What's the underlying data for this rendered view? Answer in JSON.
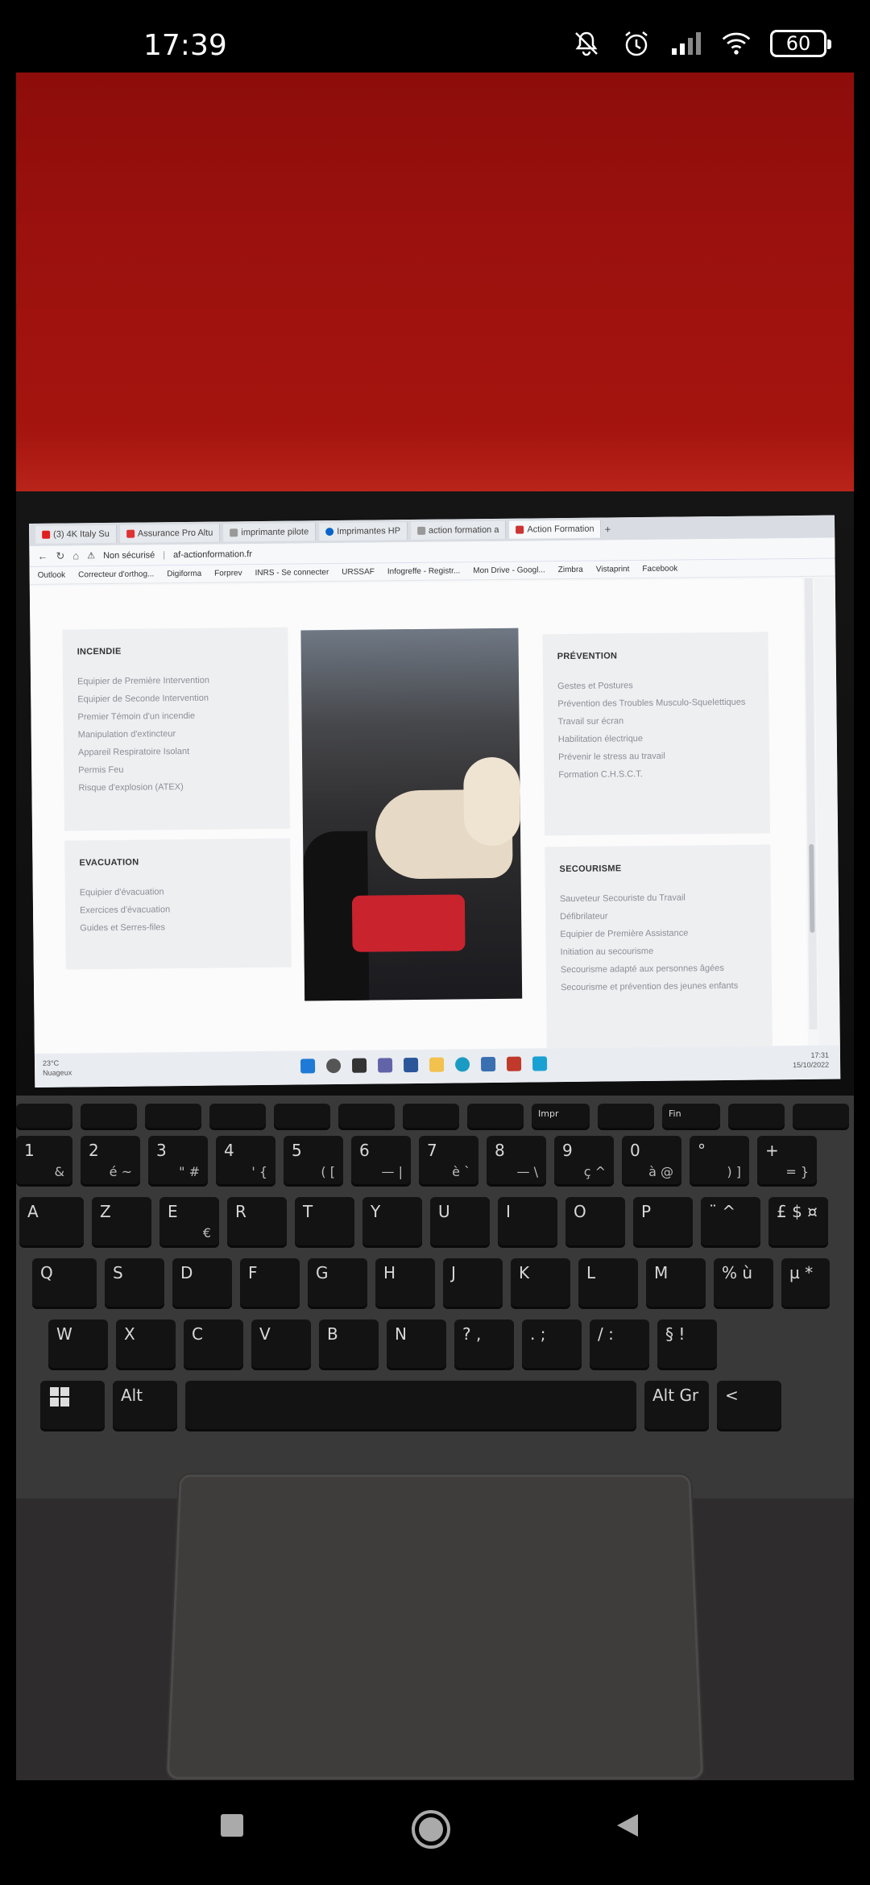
{
  "status_bar": {
    "time": "17:39",
    "battery": "60",
    "icons": [
      "mute-icon",
      "alarm-icon",
      "signal-icon",
      "wifi-icon"
    ]
  },
  "browser": {
    "tabs": [
      "(3) 4K Italy Su",
      "Assurance Pro Altu",
      "imprimante pilote",
      "Imprimantes HP",
      "action formation a",
      "Action Formation"
    ],
    "security_label": "Non sécurisé",
    "url": "af-actionformation.fr",
    "bookmarks": [
      "Outlook",
      "Correcteur d'orthog...",
      "Digiforma",
      "Forprev",
      "INRS - Se connecter",
      "URSSAF",
      "Infogreffe - Registr...",
      "Mon Drive - Googl...",
      "Zimbra",
      "Vistaprint",
      "Facebook"
    ]
  },
  "catalog": {
    "incendie": {
      "title": "INCENDIE",
      "items": [
        "Equipier de Première Intervention",
        "Equipier de Seconde Intervention",
        "Premier Témoin d'un incendie",
        "Manipulation d'extincteur",
        "Appareil Respiratoire Isolant",
        "Permis Feu",
        "Risque d'explosion (ATEX)"
      ]
    },
    "evacuation": {
      "title": "EVACUATION",
      "items": [
        "Equipier d'évacuation",
        "Exercices d'évacuation",
        "Guides et Serres-files"
      ]
    },
    "prevention": {
      "title": "PRÉVENTION",
      "items": [
        "Gestes et Postures",
        "Prévention des Troubles Musculo-Squelettiques",
        "Travail sur écran",
        "Habilitation électrique",
        "Prévenir le stress au travail",
        "Formation C.H.S.C.T."
      ]
    },
    "secourisme": {
      "title": "SECOURISME",
      "items": [
        "Sauveteur Secouriste du Travail",
        "Défibrilateur",
        "Equipier de Première Assistance",
        "Initiation au secourisme",
        "Secourisme adapté aux personnes âgées",
        "Secourisme et prévention des jeunes enfants"
      ]
    }
  },
  "taskbar": {
    "weather_temp": "23°C",
    "weather_desc": "Nuageux",
    "clock_time": "17:31",
    "clock_date": "15/10/2022"
  },
  "keyboard": {
    "function_row": [
      "Impr",
      "Fin"
    ],
    "number_row": [
      {
        "top": "1",
        "bottom": "&"
      },
      {
        "top": "2",
        "bottom": "é ~"
      },
      {
        "top": "3",
        "bottom": "\" #"
      },
      {
        "top": "4",
        "bottom": "' {"
      },
      {
        "top": "5",
        "bottom": "( ["
      },
      {
        "top": "6",
        "bottom": "— |"
      },
      {
        "top": "7",
        "bottom": "è `"
      },
      {
        "top": "8",
        "bottom": "— \\"
      },
      {
        "top": "9",
        "bottom": "ç ^"
      },
      {
        "top": "0",
        "bottom": "à @"
      },
      {
        "top": "°",
        "bottom": ") ]"
      },
      {
        "top": "+",
        "bottom": "= }"
      }
    ],
    "row_a": [
      "A",
      "Z",
      "E",
      "R",
      "T",
      "Y",
      "U",
      "I",
      "O",
      "P",
      "¨ ^",
      "£ $ ¤"
    ],
    "row_q": [
      "Q",
      "S",
      "D",
      "F",
      "G",
      "H",
      "J",
      "K",
      "L",
      "M",
      "% ù",
      "µ *"
    ],
    "row_w": [
      "W",
      "X",
      "C",
      "V",
      "B",
      "N",
      "? ,",
      ". ;",
      "/ :",
      "§ !"
    ],
    "row_bottom": [
      "Alt",
      "Alt Gr",
      "<"
    ],
    "euro": "€"
  }
}
